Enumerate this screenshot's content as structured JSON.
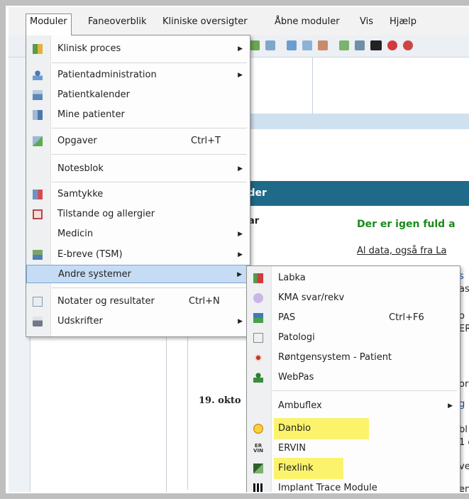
{
  "menubar": {
    "items": [
      "Moduler",
      "Faneoverblik",
      "Kliniske oversigter",
      "Åbne moduler",
      "Vis",
      "Hjælp"
    ]
  },
  "background": {
    "section_header": "eder",
    "label_left": "ar",
    "notice": "Der er igen fuld a",
    "notice_color": "#1a8a1a",
    "info_link": "Al data, også fra La",
    "date": "19. okto",
    "fragments": [
      "s",
      "as",
      "o",
      "ER",
      "or",
      "g",
      "bl",
      "1 c",
      "ve",
      "en"
    ]
  },
  "main_menu": {
    "items": [
      {
        "label": "Klinisk proces",
        "shortcut": "",
        "submenu": true,
        "icon": "grid-icon"
      },
      {
        "label": "Patientadministration",
        "shortcut": "",
        "submenu": true,
        "icon": "person-icon"
      },
      {
        "label": "Patientkalender",
        "shortcut": "",
        "submenu": false,
        "icon": "calendar-person-icon"
      },
      {
        "label": "Mine patienter",
        "shortcut": "",
        "submenu": false,
        "icon": "patients-icon"
      },
      {
        "label": "Opgaver",
        "shortcut": "Ctrl+T",
        "submenu": false,
        "icon": "tasks-icon"
      },
      {
        "label": "Notesblok",
        "shortcut": "",
        "submenu": true,
        "icon": ""
      },
      {
        "label": "Samtykke",
        "shortcut": "",
        "submenu": false,
        "icon": "consent-icon"
      },
      {
        "label": "Tilstande og allergier",
        "shortcut": "",
        "submenu": false,
        "icon": "allergy-icon"
      },
      {
        "label": "Medicin",
        "shortcut": "",
        "submenu": true,
        "icon": ""
      },
      {
        "label": "E-breve (TSM)",
        "shortcut": "",
        "submenu": true,
        "icon": "letter-icon"
      },
      {
        "label": "Andre systemer",
        "shortcut": "",
        "submenu": true,
        "icon": ""
      },
      {
        "label": "Notater og resultater",
        "shortcut": "Ctrl+N",
        "submenu": false,
        "icon": "search-notes-icon"
      },
      {
        "label": "Udskrifter",
        "shortcut": "",
        "submenu": true,
        "icon": "printer-icon"
      }
    ]
  },
  "sub_menu": {
    "items": [
      {
        "label": "Labka",
        "shortcut": "",
        "submenu": false,
        "icon": "lab-icon"
      },
      {
        "label": "KMA svar/rekv",
        "shortcut": "",
        "submenu": false,
        "icon": "microbe-icon"
      },
      {
        "label": "PAS",
        "shortcut": "Ctrl+F6",
        "submenu": false,
        "icon": "pas-icon"
      },
      {
        "label": "Patologi",
        "shortcut": "",
        "submenu": false,
        "icon": "pathology-icon"
      },
      {
        "label": "Røntgensystem - Patient",
        "shortcut": "",
        "submenu": false,
        "icon": "eye-icon"
      },
      {
        "label": "WebPas",
        "shortcut": "",
        "submenu": false,
        "icon": "person-green-icon"
      },
      {
        "label": "Ambuflex",
        "shortcut": "",
        "submenu": true,
        "icon": ""
      },
      {
        "label": "Danbio",
        "shortcut": "",
        "submenu": false,
        "icon": "smiley-icon"
      },
      {
        "label": "ERVIN",
        "shortcut": "",
        "submenu": false,
        "icon": "ervin-icon"
      },
      {
        "label": "Flexlink",
        "shortcut": "",
        "submenu": false,
        "icon": "flexlink-icon"
      },
      {
        "label": "Implant Trace Module",
        "shortcut": "",
        "submenu": false,
        "icon": "barcode-icon"
      }
    ],
    "ervin_icon_text": [
      "ER",
      "VIN"
    ]
  },
  "colors": {
    "highlight": "#fbf36c",
    "selected": "#c6dcf4",
    "teal_bar": "#1e6a88"
  }
}
